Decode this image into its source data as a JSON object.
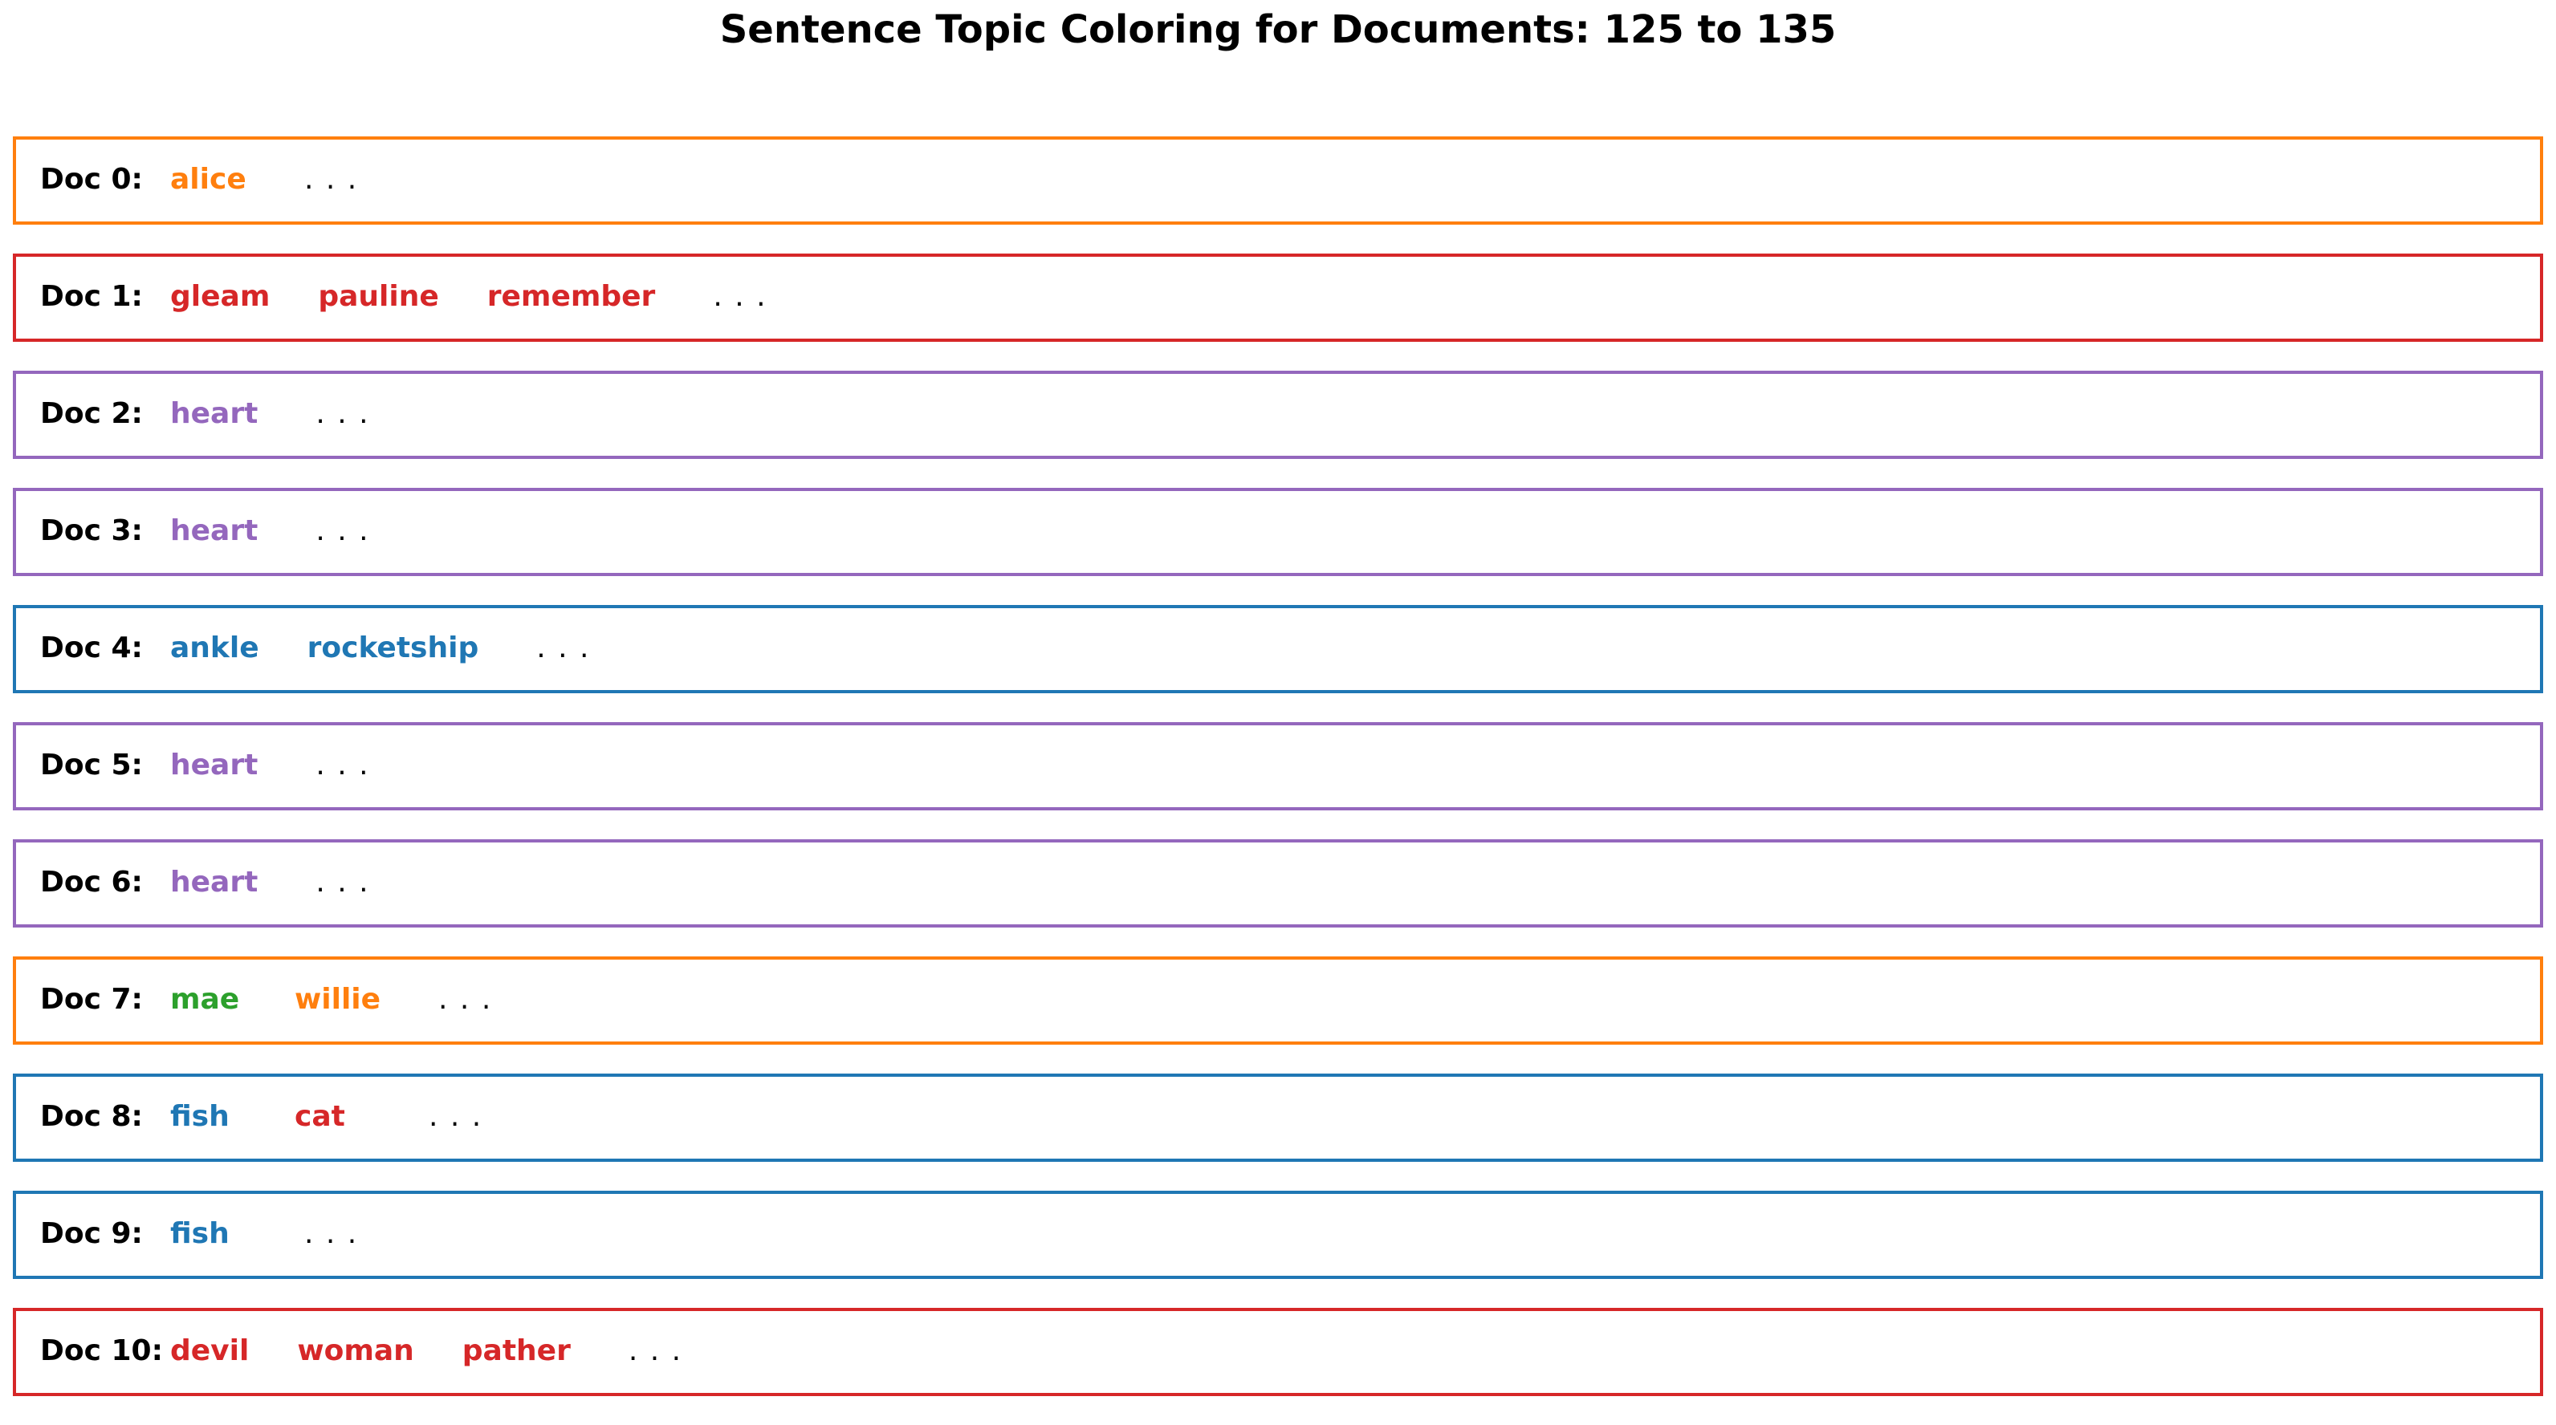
{
  "chart_data": {
    "type": "table",
    "title": "Sentence Topic Coloring for Documents: 125 to 135",
    "colors": {
      "topic_blue": "#1f77b4",
      "topic_orange": "#ff7f0e",
      "topic_green": "#2ca02c",
      "topic_red": "#d62728",
      "topic_purple": "#9467bd"
    },
    "ellipsis": ". . .",
    "docs": [
      {
        "label": "Doc 0:",
        "border_color": "#ff7f0e",
        "words": [
          {
            "text": "alice",
            "color": "#ff7f0e"
          }
        ]
      },
      {
        "label": "Doc 1:",
        "border_color": "#d62728",
        "words": [
          {
            "text": "gleam",
            "color": "#d62728"
          },
          {
            "text": "pauline",
            "color": "#d62728"
          },
          {
            "text": "remember",
            "color": "#d62728"
          }
        ]
      },
      {
        "label": "Doc 2:",
        "border_color": "#9467bd",
        "words": [
          {
            "text": "heart",
            "color": "#9467bd"
          }
        ]
      },
      {
        "label": "Doc 3:",
        "border_color": "#9467bd",
        "words": [
          {
            "text": "heart",
            "color": "#9467bd"
          }
        ]
      },
      {
        "label": "Doc 4:",
        "border_color": "#1f77b4",
        "words": [
          {
            "text": "ankle",
            "color": "#1f77b4"
          },
          {
            "text": "rocketship",
            "color": "#1f77b4"
          }
        ]
      },
      {
        "label": "Doc 5:",
        "border_color": "#9467bd",
        "words": [
          {
            "text": "heart",
            "color": "#9467bd"
          }
        ]
      },
      {
        "label": "Doc 6:",
        "border_color": "#9467bd",
        "words": [
          {
            "text": "heart",
            "color": "#9467bd"
          }
        ]
      },
      {
        "label": "Doc 7:",
        "border_color": "#ff7f0e",
        "words": [
          {
            "text": "mae",
            "color": "#2ca02c"
          },
          {
            "text": "willie",
            "color": "#ff7f0e"
          }
        ]
      },
      {
        "label": "Doc 8:",
        "border_color": "#1f77b4",
        "words": [
          {
            "text": "fish",
            "color": "#1f77b4"
          },
          {
            "text": "cat",
            "color": "#d62728"
          }
        ]
      },
      {
        "label": "Doc 9:",
        "border_color": "#1f77b4",
        "words": [
          {
            "text": "fish",
            "color": "#1f77b4"
          }
        ]
      },
      {
        "label": "Doc 10:",
        "border_color": "#d62728",
        "words": [
          {
            "text": "devil",
            "color": "#d62728"
          },
          {
            "text": "woman",
            "color": "#d62728"
          },
          {
            "text": "pather",
            "color": "#d62728"
          }
        ]
      }
    ]
  }
}
